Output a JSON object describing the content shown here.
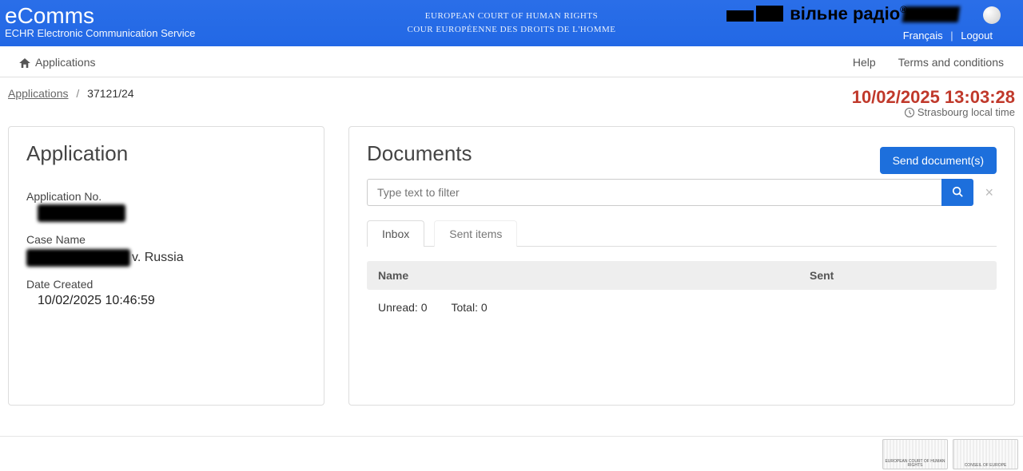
{
  "header": {
    "brand_title": "eComms",
    "brand_subtitle": "ECHR Electronic Communication Service",
    "court_line1": "EUROPEAN COURT OF HUMAN RIGHTS",
    "court_line2": "COUR EUROPÉENNE DES DROITS DE L'HOMME",
    "overlay_text": "вільне радіо",
    "link_lang": "Français",
    "link_logout": "Logout"
  },
  "navbar": {
    "applications": "Applications",
    "help": "Help",
    "terms": "Terms and conditions"
  },
  "breadcrumb": {
    "root": "Applications",
    "current": "37121/24"
  },
  "time": {
    "value": "10/02/2025 13:03:28",
    "zone": "Strasbourg local time"
  },
  "application_panel": {
    "title": "Application",
    "appno_label": "Application No.",
    "appno_value": "",
    "case_label": "Case Name",
    "case_suffix": "v. Russia",
    "date_label": "Date Created",
    "date_value": "10/02/2025 10:46:59"
  },
  "documents_panel": {
    "title": "Documents",
    "send_btn": "Send document(s)",
    "filter_placeholder": "Type text to filter",
    "tab_inbox": "Inbox",
    "tab_sent": "Sent items",
    "th_name": "Name",
    "th_sent": "Sent",
    "unread_label": "Unread:",
    "unread_value": "0",
    "total_label": "Total:",
    "total_value": "0"
  },
  "footer": {
    "label1": "EUROPEAN COURT OF HUMAN RIGHTS",
    "label2": "CONSEIL OF EUROPE"
  }
}
